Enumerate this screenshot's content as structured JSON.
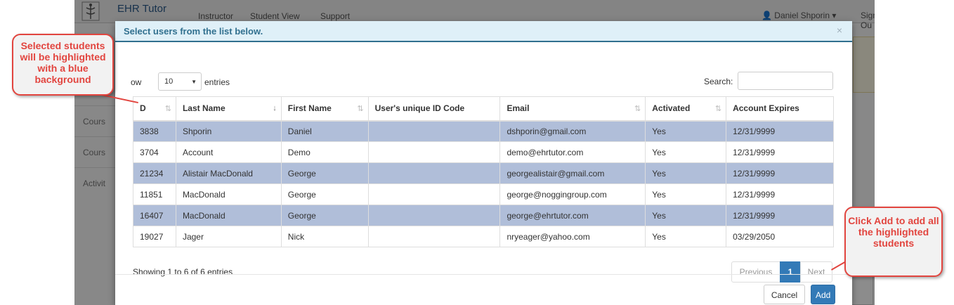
{
  "navbar": {
    "brand": "EHR Tutor",
    "items": [
      "Instructor",
      "Student View",
      "Support"
    ],
    "user": "Daniel Shporin",
    "signout": "Sign Ou"
  },
  "sidebar": {
    "items": [
      "Cours",
      "Cours",
      "Activit"
    ]
  },
  "modal": {
    "title": "Select users from the list below.",
    "close_glyph": "×",
    "length_label": "ow",
    "length_value": "10",
    "entries_label": "entries",
    "search_label": "Search:",
    "search_value": "",
    "columns": [
      "D",
      "Last Name",
      "First Name",
      "User's unique ID Code",
      "Email",
      "Activated",
      "Account Expires"
    ],
    "rows": [
      {
        "id": "3838",
        "last": "Shporin",
        "first": "Daniel",
        "code": "",
        "email": "dshporin@gmail.com",
        "activated": "Yes",
        "expires": "12/31/9999",
        "selected": true
      },
      {
        "id": "3704",
        "last": "Account",
        "first": "Demo",
        "code": "",
        "email": "demo@ehrtutor.com",
        "activated": "Yes",
        "expires": "12/31/9999",
        "selected": false
      },
      {
        "id": "21234",
        "last": "Alistair MacDonald",
        "first": "George",
        "code": "",
        "email": "georgealistair@gmail.com",
        "activated": "Yes",
        "expires": "12/31/9999",
        "selected": true
      },
      {
        "id": "11851",
        "last": "MacDonald",
        "first": "George",
        "code": "",
        "email": "george@noggingroup.com",
        "activated": "Yes",
        "expires": "12/31/9999",
        "selected": false
      },
      {
        "id": "16407",
        "last": "MacDonald",
        "first": "George",
        "code": "",
        "email": "george@ehrtutor.com",
        "activated": "Yes",
        "expires": "12/31/9999",
        "selected": true
      },
      {
        "id": "19027",
        "last": "Jager",
        "first": "Nick",
        "code": "",
        "email": "nryeager@yahoo.com",
        "activated": "Yes",
        "expires": "03/29/2050",
        "selected": false
      }
    ],
    "info": "Showing 1 to 6 of 6 entries",
    "pagination": {
      "previous": "Previous",
      "current": "1",
      "next": "Next"
    },
    "buttons": {
      "cancel": "Cancel",
      "add": "Add"
    }
  },
  "callouts": {
    "left": "Selected students will be highlighted with a blue background",
    "right": "Click Add to add all the highlighted students"
  },
  "colors": {
    "selected_row": "#b0bed9",
    "primary": "#337ab7",
    "header_bg": "#dff0f8",
    "callout_border": "#e2453f"
  }
}
